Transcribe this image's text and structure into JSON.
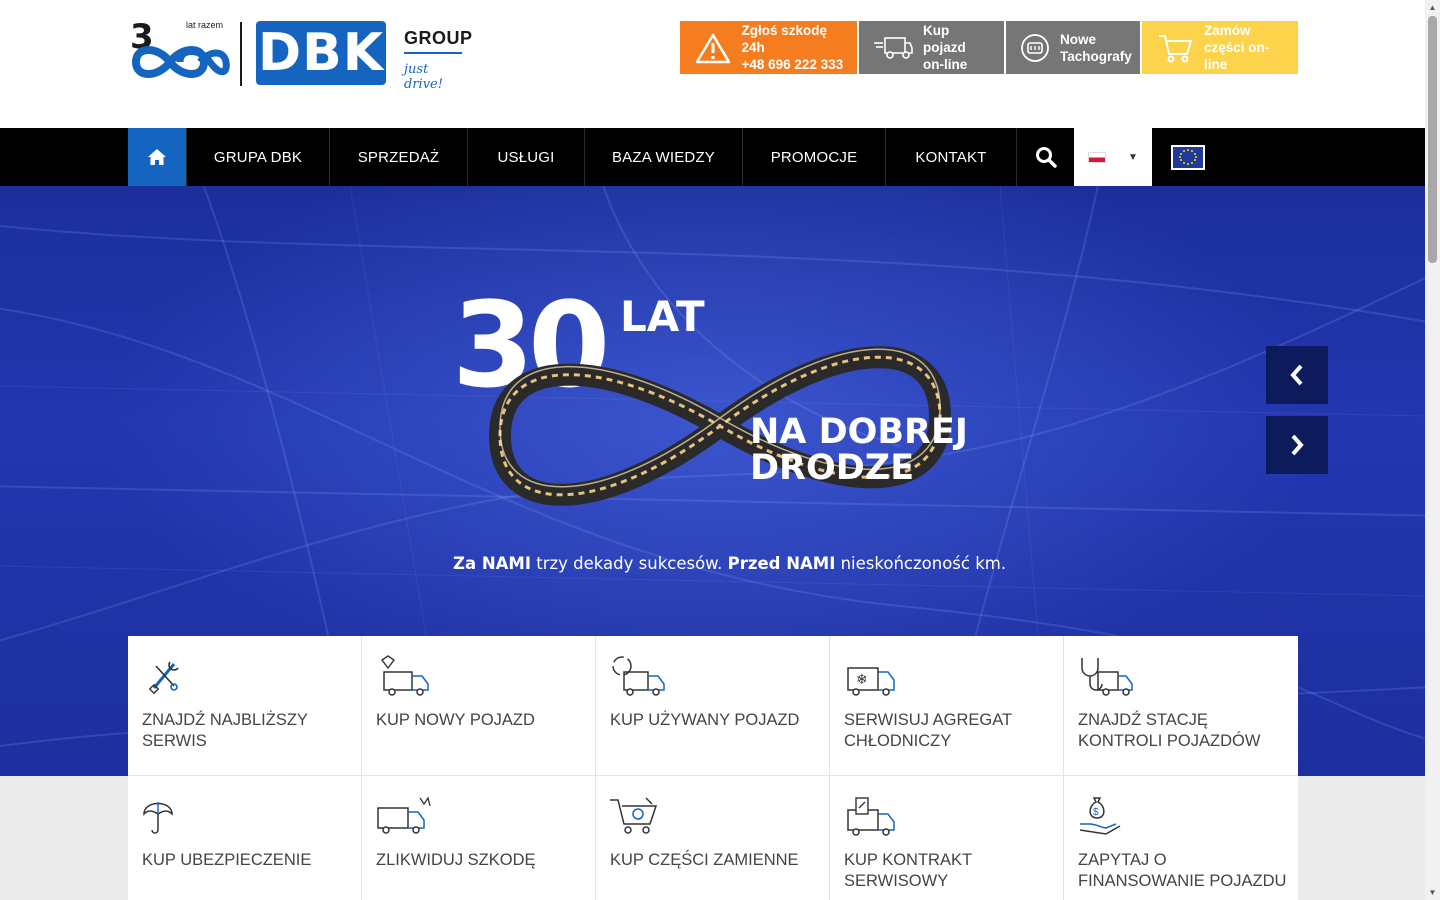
{
  "logo": {
    "years_text": "lat razem",
    "brand": "DBK",
    "group": "GROUP",
    "tagline": "just drive!"
  },
  "top_buttons": [
    {
      "line1": "Zgłoś szkodę 24h",
      "line2": "+48 696 222 333",
      "icon": "warning-icon",
      "color": "#f57c1f"
    },
    {
      "line1": "Kup pojazd",
      "line2": "on-line",
      "icon": "truck-icon",
      "color": "#767676"
    },
    {
      "line1": "Nowe",
      "line2": "Tachografy",
      "icon": "tachograph-icon",
      "color": "#767676"
    },
    {
      "line1": "Zamów",
      "line2": "części on-line",
      "icon": "cart-icon",
      "color": "#fcd34a"
    }
  ],
  "nav": {
    "items": [
      "GRUPA DBK",
      "SPRZEDAŻ",
      "USŁUGI",
      "BAZA WIEDZY",
      "PROMOCJE",
      "KONTAKT"
    ],
    "accent": "#1565c0"
  },
  "hero": {
    "number": "30",
    "lat": "LAT",
    "line1": "NA DOBREJ",
    "line2": "DRODZE",
    "sub_part1": "Za NAMI",
    "sub_part2": " trzy dekady sukcesów. ",
    "sub_part3": "Przed NAMI",
    "sub_part4": " nieskończoność km."
  },
  "tiles": [
    {
      "label": "ZNAJDŹ NAJBLIŻSZY SERWIS",
      "icon": "tools-icon"
    },
    {
      "label": "KUP NOWY POJAZD",
      "icon": "diamond-truck-icon"
    },
    {
      "label": "KUP UŻYWANY POJAZD",
      "icon": "recycle-truck-icon"
    },
    {
      "label": "SERWISUJ AGREGAT CHŁODNICZY",
      "icon": "snowflake-truck-icon"
    },
    {
      "label": "ZNAJDŹ STACJĘ KONTROLI POJAZDÓW",
      "icon": "stethoscope-truck-icon"
    },
    {
      "label": "KUP UBEZPIECZENIE",
      "icon": "umbrella-icon"
    },
    {
      "label": "ZLIKWIDUJ SZKODĘ",
      "icon": "crash-truck-icon"
    },
    {
      "label": "KUP CZĘŚCI ZAMIENNE",
      "icon": "parts-cart-icon"
    },
    {
      "label": "KUP KONTRAKT SERWISOWY",
      "icon": "contract-truck-icon"
    },
    {
      "label": "ZAPYTAJ O FINANSOWANIE POJAZDU",
      "icon": "money-hand-icon"
    }
  ]
}
